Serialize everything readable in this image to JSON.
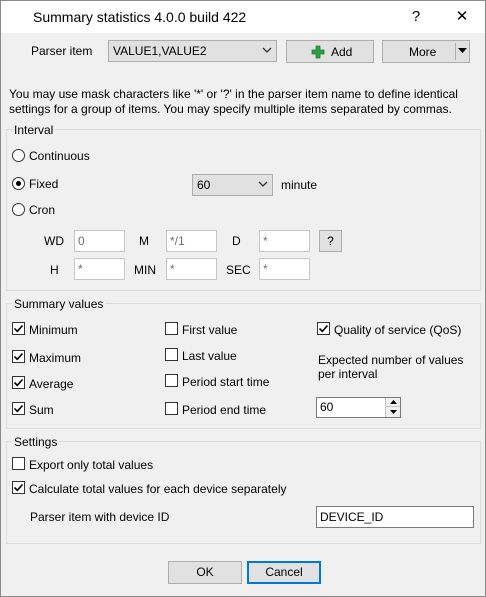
{
  "window": {
    "title": "Summary statistics 4.0.0 build 422",
    "help_glyph": "?",
    "close_glyph": "✕"
  },
  "parser": {
    "label": "Parser item",
    "value": "VALUE1,VALUE2",
    "add_label": "Add",
    "more_label": "More"
  },
  "description": "You may use mask characters like '*' or '?' in the parser item name to define identical settings for a group of items. You may specify multiple items separated by commas.",
  "interval": {
    "title": "Interval",
    "continuous": "Continuous",
    "fixed": "Fixed",
    "cron": "Cron",
    "selected": "Fixed",
    "fixed_value": "60",
    "fixed_unit": "minute",
    "cron_fields": {
      "wd_label": "WD",
      "wd_value": "0",
      "m_label": "M",
      "m_value": "*/1",
      "d_label": "D",
      "d_value": "*",
      "h_label": "H",
      "h_value": "*",
      "min_label": "MIN",
      "min_value": "*",
      "sec_label": "SEC",
      "sec_value": "*",
      "help_label": "?"
    }
  },
  "summary": {
    "title": "Summary values",
    "minimum": {
      "label": "Minimum",
      "checked": true
    },
    "maximum": {
      "label": "Maximum",
      "checked": true
    },
    "average": {
      "label": "Average",
      "checked": true
    },
    "sum": {
      "label": "Sum",
      "checked": true
    },
    "first_value": {
      "label": "First value",
      "checked": false
    },
    "last_value": {
      "label": "Last value",
      "checked": false
    },
    "period_start": {
      "label": "Period start time",
      "checked": false
    },
    "period_end": {
      "label": "Period end time",
      "checked": false
    },
    "qos": {
      "label": "Quality of service (QoS)",
      "checked": true
    },
    "expected_label": "Expected number of values per interval",
    "expected_value": "60"
  },
  "settings": {
    "title": "Settings",
    "export_total": {
      "label": "Export only total values",
      "checked": false
    },
    "calc_per_device": {
      "label": "Calculate total values for each device separately",
      "checked": true
    },
    "device_id_label": "Parser item with device ID",
    "device_id_value": "DEVICE_ID"
  },
  "footer": {
    "ok_label": "OK",
    "cancel_label": "Cancel"
  },
  "colors": {
    "add_icon": "#2ea043",
    "focus_border": "#0078d7",
    "dialog_bg": "#f0f0f0"
  }
}
